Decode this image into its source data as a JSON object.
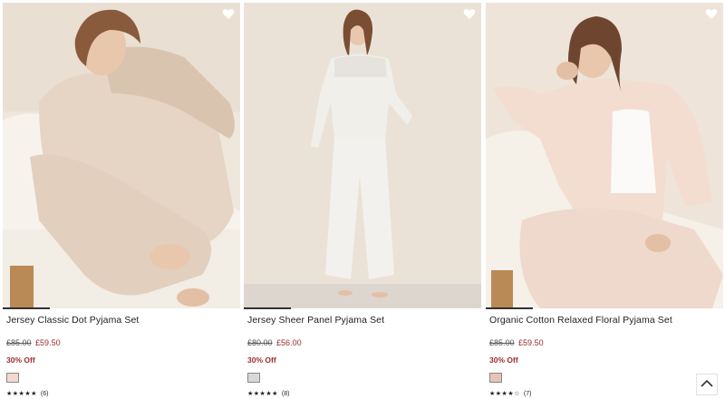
{
  "products": [
    {
      "name": "Jersey Classic Dot Pyjama Set",
      "was_price": "£85.00",
      "sale_price": "£59.50",
      "discount": "30% Off",
      "swatch_color": "#f3d9cc",
      "stars": "★★★★★",
      "review_count": "(6)",
      "wishlist_icon": "heart-icon"
    },
    {
      "name": "Jersey Sheer Panel Pyjama Set",
      "was_price": "£80.00",
      "sale_price": "£56.00",
      "discount": "30% Off",
      "swatch_color": "#d8d8d6",
      "stars": "★★★★★",
      "review_count": "(8)",
      "wishlist_icon": "heart-icon"
    },
    {
      "name": "Organic Cotton Relaxed Floral Pyjama Set",
      "was_price": "£85.00",
      "sale_price": "£59.50",
      "discount": "30% Off",
      "swatch_color": "#e9c4b6",
      "stars": "★★★★☆",
      "review_count": "(7)",
      "wishlist_icon": "heart-icon"
    }
  ],
  "back_to_top_icon": "chevron-up-icon",
  "colors": {
    "sale": "#9b2c2c",
    "text": "#222222"
  }
}
